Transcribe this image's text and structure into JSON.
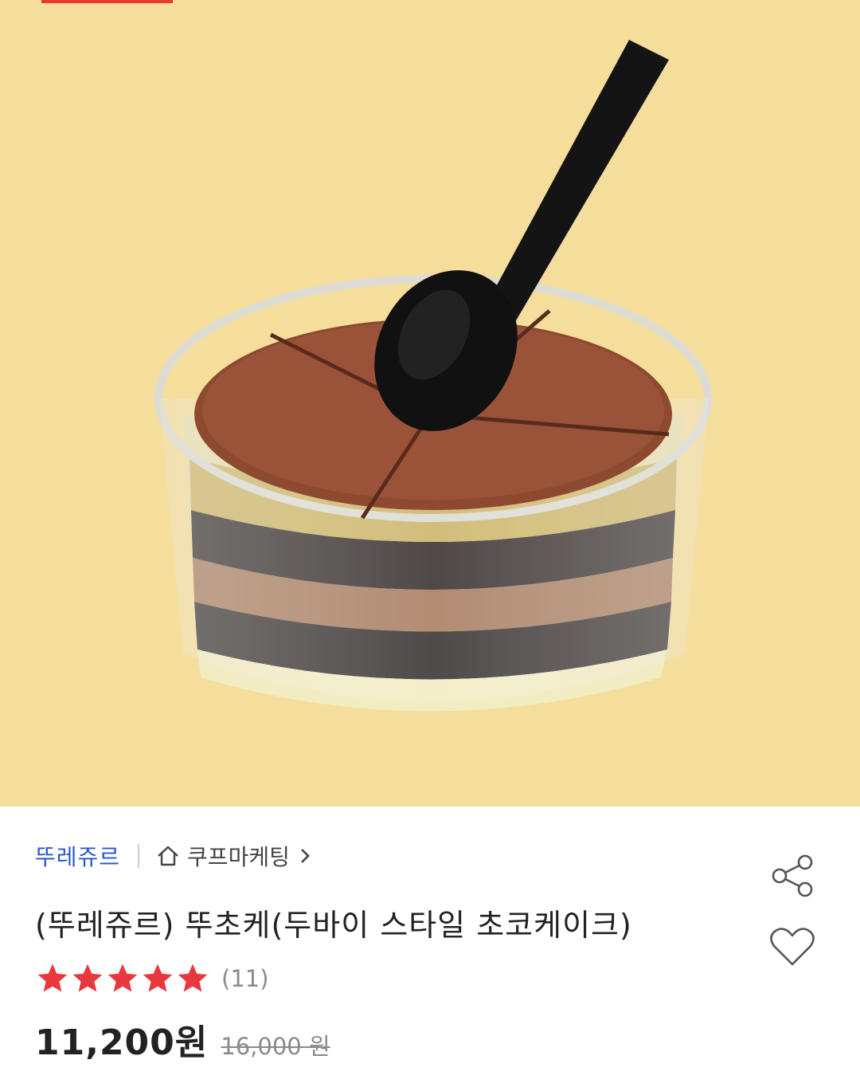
{
  "product": {
    "image_alt": "chocolate cake cup with black spoon",
    "brand": "뚜레쥬르",
    "seller": "쿠프마케팅",
    "title": "(뚜레쥬르) 뚜초케(두바이 스타일 초코케이크)",
    "rating": 5,
    "review_count": "(11)",
    "price": "11,200원",
    "original_price": "16,000 원"
  },
  "icons": {
    "share": "share-icon",
    "wishlist": "heart-icon",
    "seller_home": "home-icon",
    "seller_link": "chevron-right-icon",
    "star": "star-icon"
  },
  "colors": {
    "hero_bg": "#f5de9c",
    "brand_link": "#2b58c8",
    "star": "#e8383d"
  }
}
